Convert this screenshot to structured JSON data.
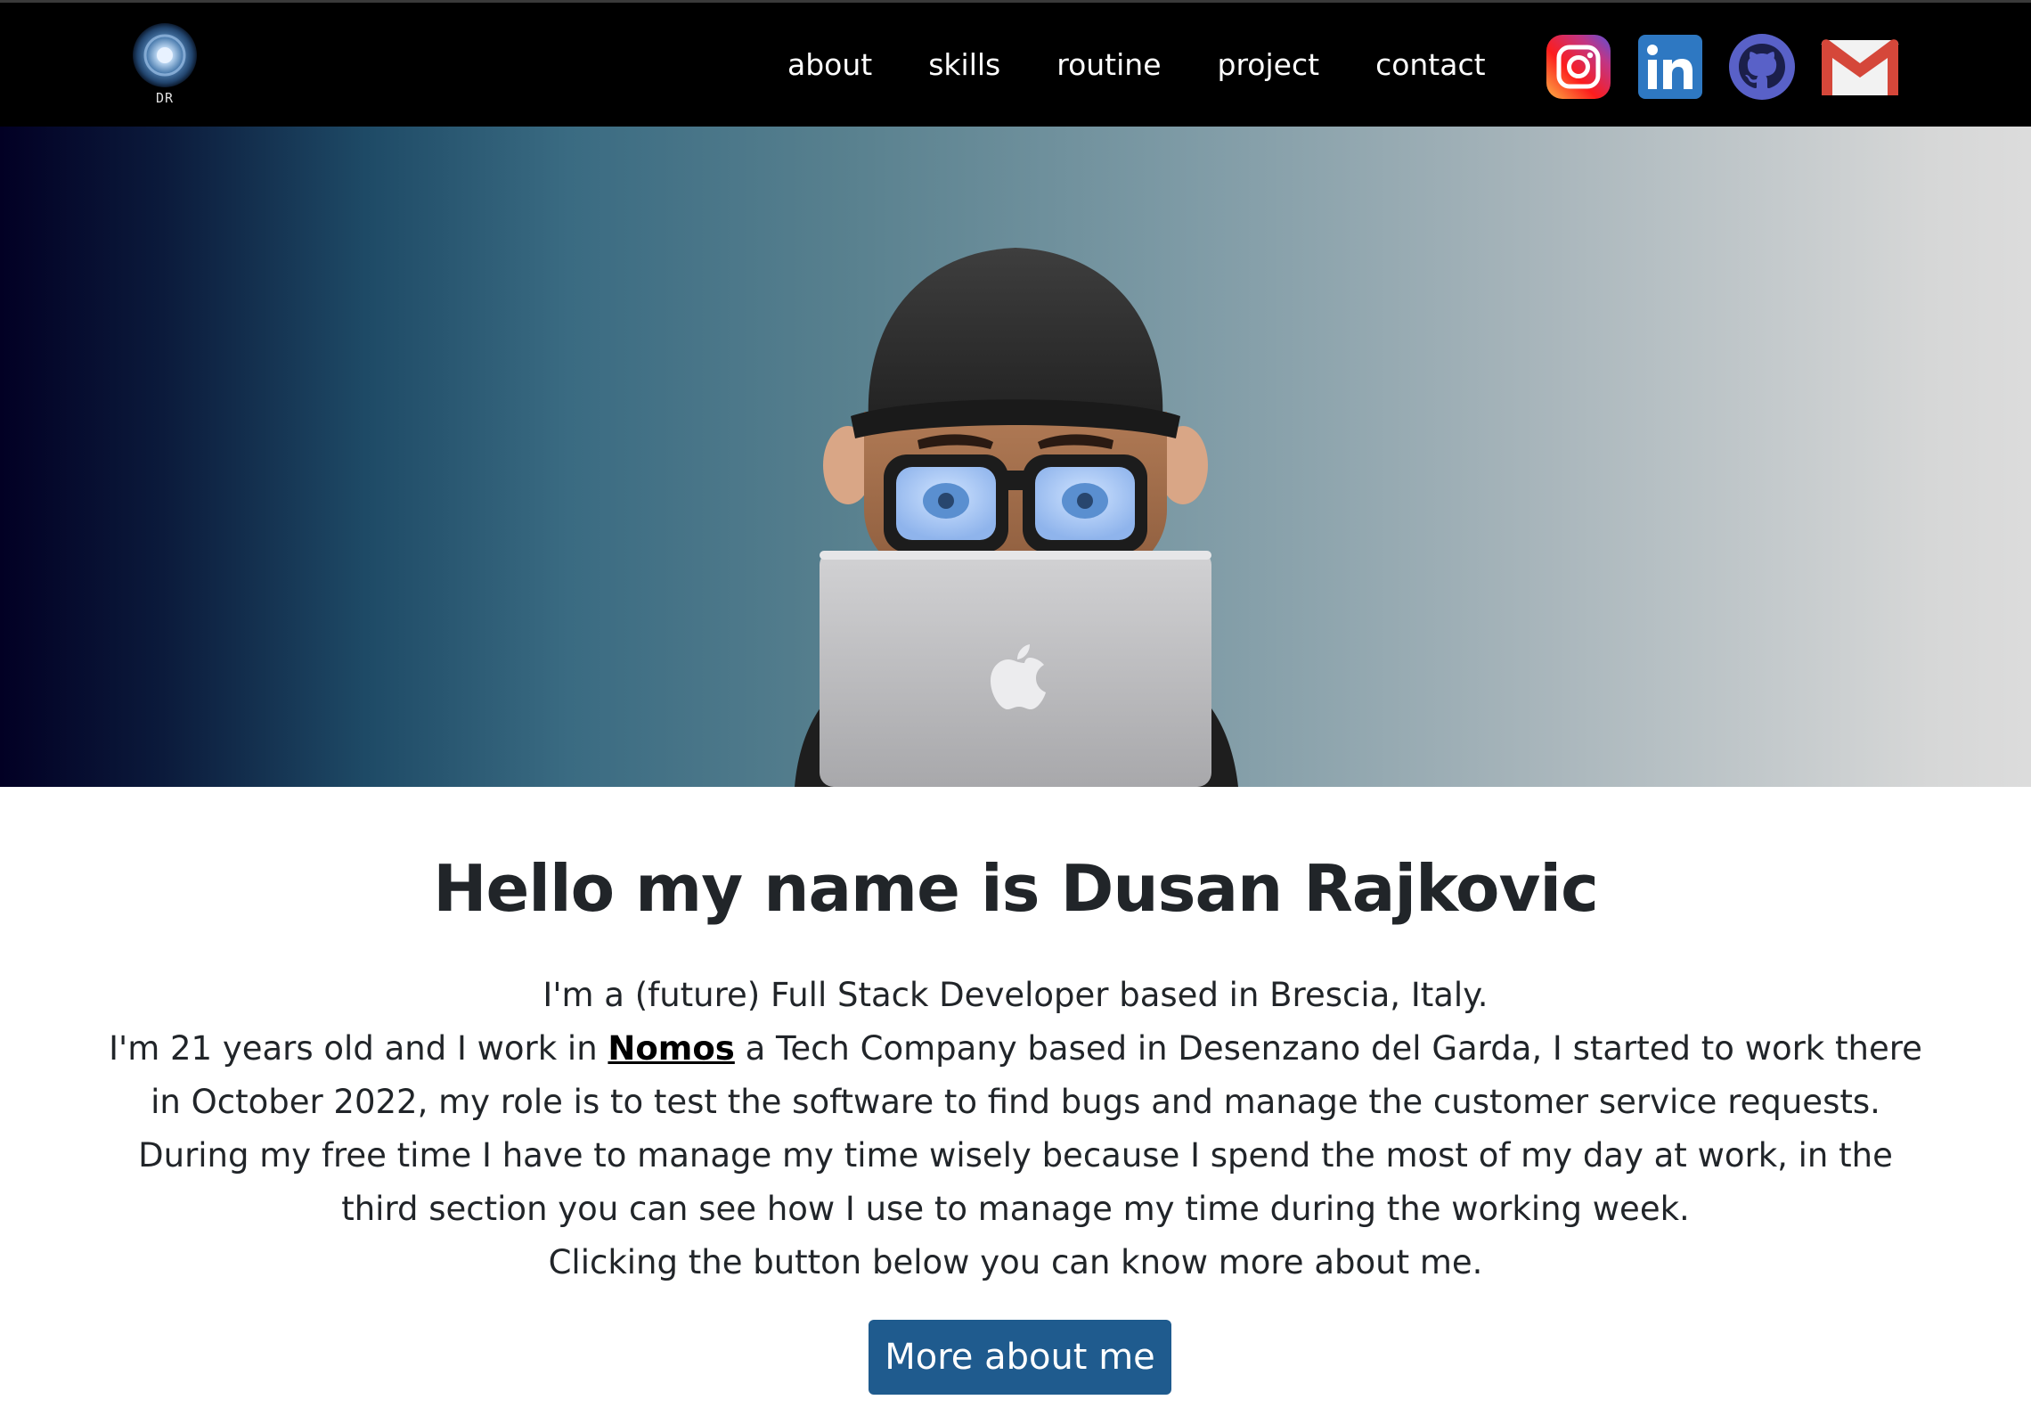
{
  "navbar": {
    "logo_text": "DR",
    "links": [
      {
        "label": "about"
      },
      {
        "label": "skills"
      },
      {
        "label": "routine"
      },
      {
        "label": "project"
      },
      {
        "label": "contact"
      }
    ],
    "socials": [
      {
        "icon": "instagram-icon"
      },
      {
        "icon": "linkedin-icon"
      },
      {
        "icon": "github-icon"
      },
      {
        "icon": "gmail-icon"
      }
    ]
  },
  "hero": {
    "image": "memoji-avatar-with-cap-glasses-laptop"
  },
  "intro": {
    "headline": "Hello my name is Dusan Rajkovic",
    "line1": "I'm a (future) Full Stack Developer based in Brescia, Italy.",
    "line2_before": "I'm 21 years old and I work in ",
    "company": "Nomos",
    "line2_after": " a Tech Company based in Desenzano del Garda, I started to work there in October 2022, my role is to test the software to find bugs and manage the customer service requests. During my free time I have to manage my time wisely because I spend the most of my day at work, in the third section you can see how I use to manage my time during the working week.",
    "line3": "Clicking the button below you can know more about me.",
    "button_label": "More about me"
  },
  "colors": {
    "navbar_bg": "#000000",
    "button_bg": "#1f5b8e",
    "text": "#212529"
  }
}
